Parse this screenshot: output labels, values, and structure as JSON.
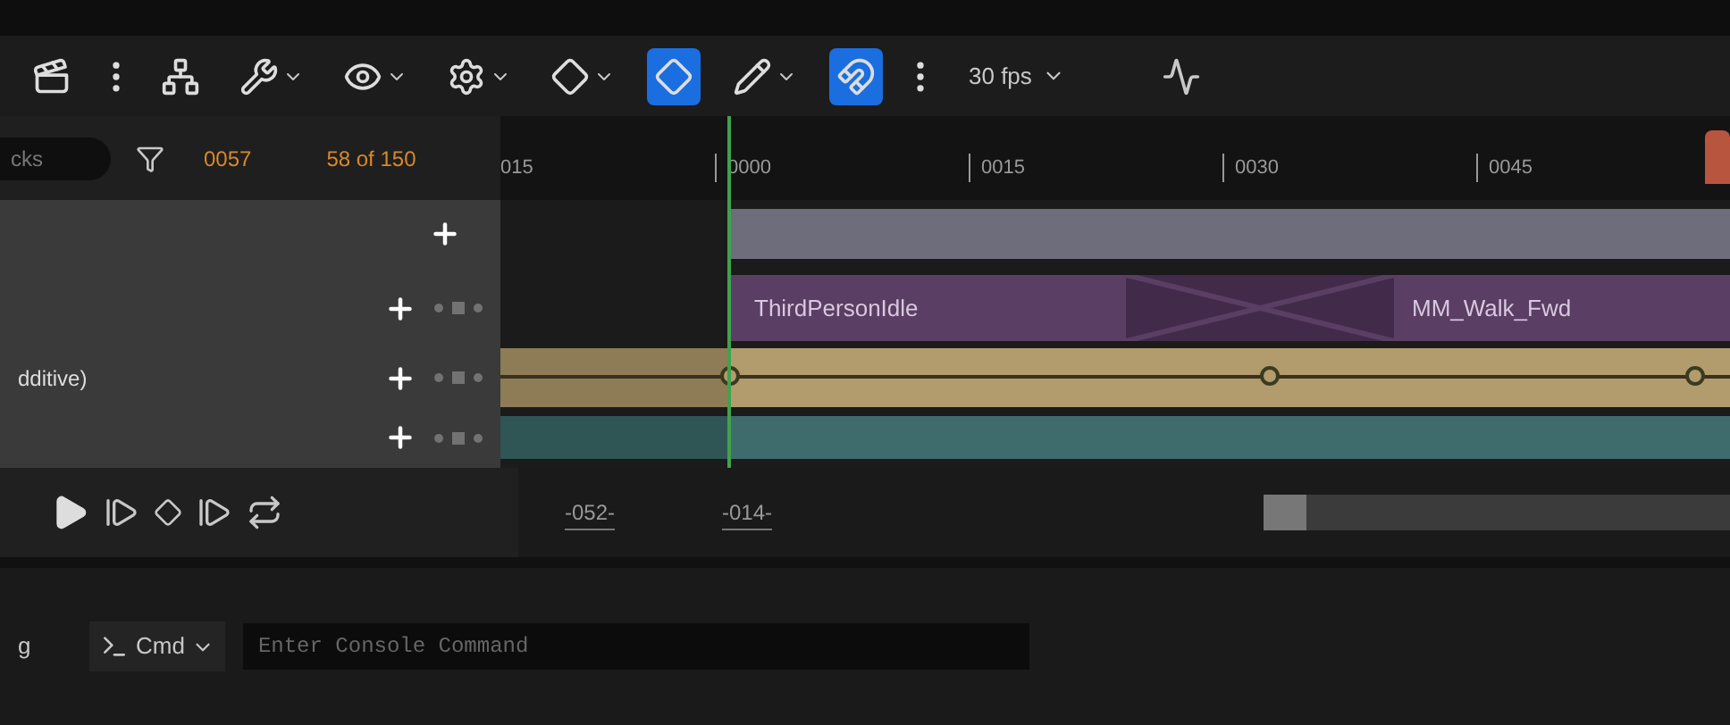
{
  "toolbar": {
    "items": [
      {
        "kind": "clapper",
        "active": false,
        "menu": false
      },
      {
        "kind": "more",
        "active": false,
        "menu": false
      },
      {
        "kind": "tree",
        "active": false,
        "menu": false
      },
      {
        "kind": "wrench",
        "active": false,
        "menu": true
      },
      {
        "kind": "eye",
        "active": false,
        "menu": true
      },
      {
        "kind": "render",
        "active": false,
        "menu": true
      },
      {
        "kind": "diamond",
        "active": false,
        "menu": true
      },
      {
        "kind": "key",
        "active": true,
        "menu": false
      },
      {
        "kind": "pencil",
        "active": false,
        "menu": true
      },
      {
        "kind": "magnet",
        "active": true,
        "menu": false
      },
      {
        "kind": "more",
        "active": false,
        "menu": false
      }
    ],
    "frame_rate": "30 fps"
  },
  "outliner": {
    "search": "cks",
    "current_frame": "0057",
    "count": "58 of 150",
    "rows": [
      {
        "kind": "folder"
      },
      {
        "kind": "track"
      },
      {
        "kind": "track",
        "label": "dditive)"
      },
      {
        "kind": "track"
      }
    ]
  },
  "timeline": {
    "ruler": [
      "015",
      "0000",
      "0015",
      "0030",
      "0045"
    ],
    "tracks": [
      {
        "kind": "bar",
        "color": "#6e6d7b"
      },
      {
        "kind": "clips",
        "clips": [
          {
            "label": "ThirdPersonIdle"
          },
          {
            "label": "MM_Walk_Fwd"
          }
        ]
      },
      {
        "kind": "keys",
        "color": "#b29b6c"
      },
      {
        "kind": "bar",
        "color": "#3e6b6c"
      }
    ]
  },
  "transport": {
    "start": "-052-",
    "end": "-014-"
  },
  "console": {
    "tab": "g",
    "mode": "Cmd",
    "placeholder": "Enter Console Command"
  }
}
